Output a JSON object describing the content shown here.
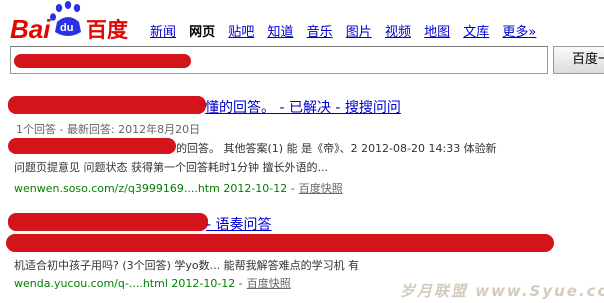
{
  "logo": {
    "left_text": "Bai",
    "paw_text": "du",
    "right_text": "百度"
  },
  "nav": {
    "items": [
      "新闻",
      "网页",
      "贴吧",
      "知道",
      "音乐",
      "图片",
      "视频",
      "地图",
      "文库",
      "更多»"
    ],
    "current": "网页"
  },
  "search": {
    "button_label": "百度一下",
    "query": ""
  },
  "results": [
    {
      "title_tail": "懂的回答。 - 已解决 - 搜搜问问",
      "meta": "1个回答 - 最新回答: 2012年8月20日",
      "snippet_line1": "的回答。 其他答案(1) 能 是《帝》、2 2012-08-20 14:33 体验新",
      "snippet_line2": "问题页提意见 问题状态 获得第一个回答耗时1分钟 擅长外语的...",
      "url": "wenwen.soso.com/z/q3999169....htm 2012-10-12 -",
      "cache": "百度快照"
    },
    {
      "title_tail": "- 语奏问答",
      "snippet": "机适合初中孩子用吗? (3个回答) 学yo数... 能帮我解答难点的学习机 有",
      "url": "wenda.yucou.com/q-....html 2012-10-12 -",
      "cache": "百度快照"
    }
  ],
  "watermark": "岁月联盟 www.Syue.com",
  "colors": {
    "brand_red": "#e10602",
    "brand_blue": "#2932e1",
    "link": "#0000cc",
    "url_green": "#008000",
    "redaction": "#d3151b"
  }
}
